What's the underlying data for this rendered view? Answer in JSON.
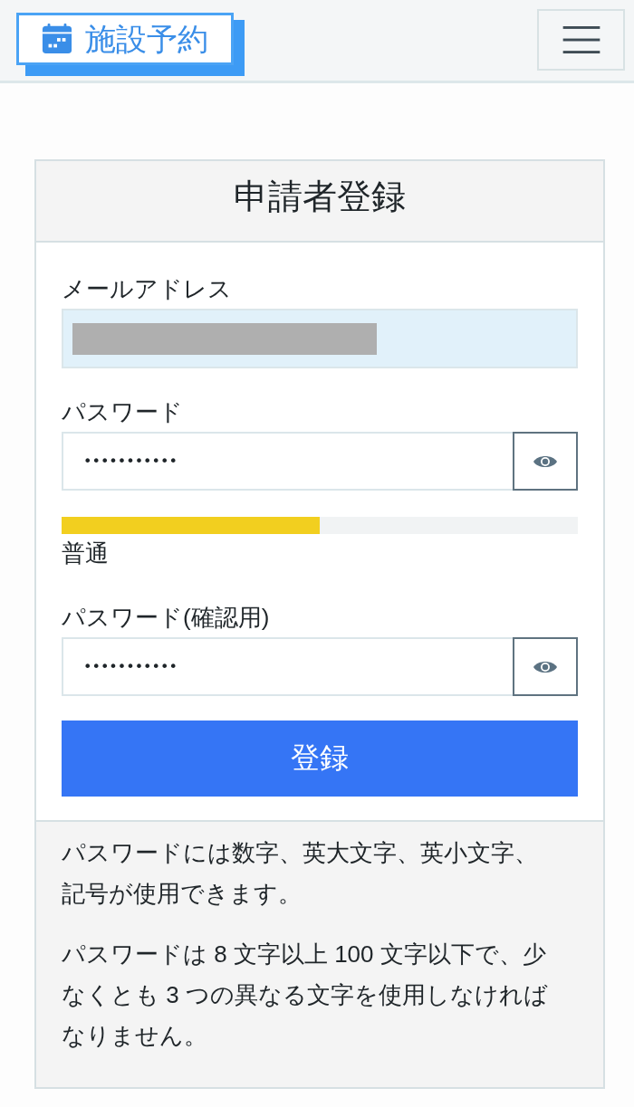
{
  "header": {
    "logo": {
      "text": "施設予約"
    }
  },
  "form": {
    "title": "申請者登録",
    "fields": [
      {
        "kind": "email",
        "label": "メールアドレス",
        "redacted": true
      },
      {
        "kind": "password",
        "label": "パスワード",
        "value": "•••••••••••",
        "strength": {
          "level": 0.5,
          "label": "普通"
        }
      },
      {
        "kind": "password",
        "label": "パスワード(確認用)",
        "value": "•••••••••••"
      }
    ],
    "submit_button": "登録",
    "notes": [
      "パスワードには数字、英大文字、英小文字、記号が使用できます。",
      "パスワードは 8 文字以上 100 文字以下で、少なくとも 3 つの異なる文字を使用しなければなりません。"
    ]
  }
}
